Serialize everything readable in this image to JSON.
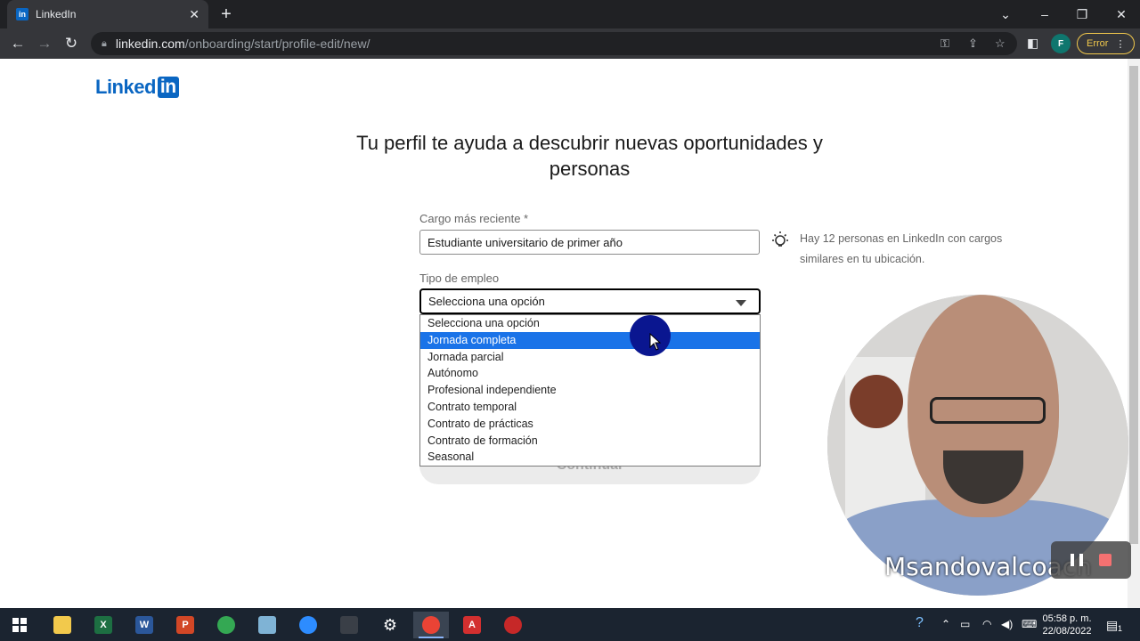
{
  "browser": {
    "tab_title": "LinkedIn",
    "favicon_text": "in",
    "new_tab": "+",
    "url_host": "linkedin.com",
    "url_path": "/onboarding/start/profile-edit/new/",
    "profile_initial": "F",
    "error_label": "Error"
  },
  "logo": {
    "word": "Linked",
    "box": "in",
    "color": "#0a66c2"
  },
  "heading": "Tu perfil te ayuda a descubrir nuevas oportunidades y personas",
  "form": {
    "cargo_label": "Cargo más reciente *",
    "cargo_value": "Estudiante universitario de primer año",
    "hint": "Hay 12 personas en LinkedIn con cargos similares en tu ubicación.",
    "tipo_label": "Tipo de empleo",
    "tipo_value": "Selecciona una opción",
    "continue_label": "Continuar",
    "options": [
      "Selecciona una opción",
      "Jornada completa",
      "Jornada parcial",
      "Autónomo",
      "Profesional independiente",
      "Contrato temporal",
      "Contrato de prácticas",
      "Contrato de formación",
      "Seasonal"
    ],
    "highlighted_option": "Jornada completa"
  },
  "overlay": {
    "watermark": "Msandovalcoach"
  },
  "taskbar": {
    "time": "05:58 p. m.",
    "date": "22/08/2022",
    "notification_count": "1",
    "apps": [
      "explorer-icon",
      "excel-icon",
      "word-icon",
      "powerpoint-icon",
      "chrome-icon",
      "notes-icon",
      "zoom-icon",
      "app-icon",
      "settings-icon",
      "chrome-active-icon",
      "acrobat-icon",
      "recorder-icon"
    ]
  },
  "colors": {
    "accent": "#0a66c2",
    "selection": "#1a73e8",
    "cursor_highlight": "#0a1690"
  }
}
